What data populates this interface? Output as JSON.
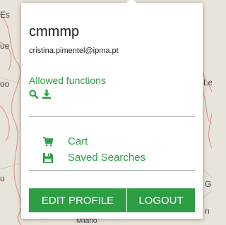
{
  "map": {
    "labels": [
      "Es",
      "ue",
      "oo",
      "Le",
      "u",
      "G",
      "n",
      "Milano"
    ]
  },
  "profile": {
    "username": "cmmmp",
    "email": "cristina.pimentel@ipma.pt"
  },
  "allowed_functions": {
    "title": "Allowed functions",
    "icons": [
      "search-icon",
      "download-icon"
    ]
  },
  "menu": {
    "cart_label": "Cart",
    "saved_searches_label": "Saved Searches"
  },
  "buttons": {
    "edit_profile": "EDIT PROFILE",
    "logout": "LOGOUT"
  },
  "colors": {
    "accent": "#2e9e45",
    "text": "#1a1a1a"
  }
}
